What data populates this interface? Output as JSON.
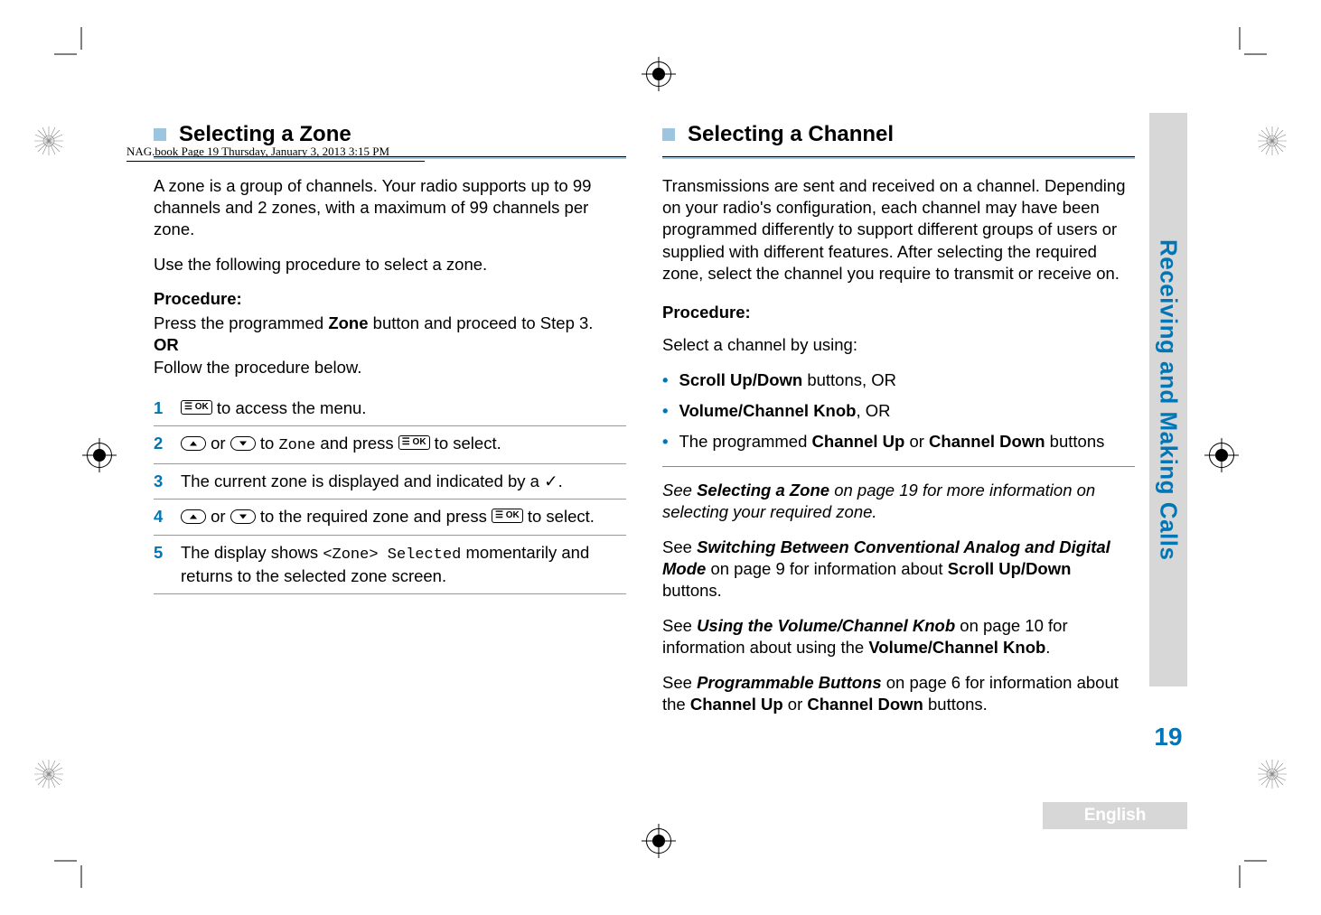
{
  "header_line": "NAG.book  Page 19  Thursday, January 3, 2013  3:15 PM",
  "side_tab": "Receiving and Making Calls",
  "page_number": "19",
  "footer_lang": "English",
  "left": {
    "heading": "Selecting a Zone",
    "intro": "A zone is a group of channels. Your radio supports up to 99 channels and 2 zones, with a maximum of 99 channels per zone.",
    "use": "Use the following procedure to select a zone.",
    "procedure_label": "Procedure:",
    "press_line_a": "Press the programmed ",
    "press_line_b": "Zone",
    "press_line_c": " button and proceed to Step 3.",
    "or": "OR",
    "follow": "Follow the procedure below.",
    "steps": {
      "s1": " to access the menu.",
      "s2_a": " or ",
      "s2_b": " to ",
      "s2_zone": "Zone",
      "s2_c": " and press ",
      "s2_d": " to select.",
      "s3_a": "The current zone is displayed and indicated by a ",
      "s3_b": ".",
      "s4_a": " or ",
      "s4_b": " to the required zone and press ",
      "s4_c": " to select.",
      "s5_a": "The display shows ",
      "s5_code": "<Zone> Selected",
      "s5_b": " momentarily and returns to the selected zone screen."
    },
    "nums": {
      "n1": "1",
      "n2": "2",
      "n3": "3",
      "n4": "4",
      "n5": "5"
    }
  },
  "right": {
    "heading": "Selecting a Channel",
    "intro": "Transmissions are sent and received on a channel. Depending on your radio's configuration, each channel may have been programmed differently to support different groups of users or supplied with different features. After selecting the required zone, select the channel you require to transmit or receive on.",
    "procedure_label": "Procedure:",
    "select_by": "Select a channel by using:",
    "bullets": {
      "b1_a": "Scroll Up/Down",
      "b1_b": " buttons, OR",
      "b2_a": "Volume/Channel Knob",
      "b2_b": ", OR",
      "b3_a": "The programmed ",
      "b3_b": "Channel Up",
      "b3_c": " or ",
      "b3_d": "Channel Down",
      "b3_e": " buttons"
    },
    "refs": {
      "r1_a": "See ",
      "r1_b": "Selecting a Zone",
      "r1_c": " on page 19 for more information on selecting your required zone.",
      "r2_a": "See ",
      "r2_b": "Switching Between Conventional Analog and Digital Mode",
      "r2_c": " on page 9 for information about ",
      "r2_d": "Scroll Up/Down",
      "r2_e": " buttons.",
      "r3_a": "See ",
      "r3_b": "Using the Volume/Channel Knob",
      "r3_c": " on page 10 for information about using the ",
      "r3_d": "Volume/Channel Knob",
      "r3_e": ".",
      "r4_a": "See ",
      "r4_b": "Programmable Buttons",
      "r4_c": " on page 6 for information about the ",
      "r4_d": "Channel Up",
      "r4_e": " or ",
      "r4_f": "Channel Down",
      "r4_g": " buttons."
    }
  },
  "icons": {
    "ok": "☰ OK",
    "check": "✓"
  }
}
